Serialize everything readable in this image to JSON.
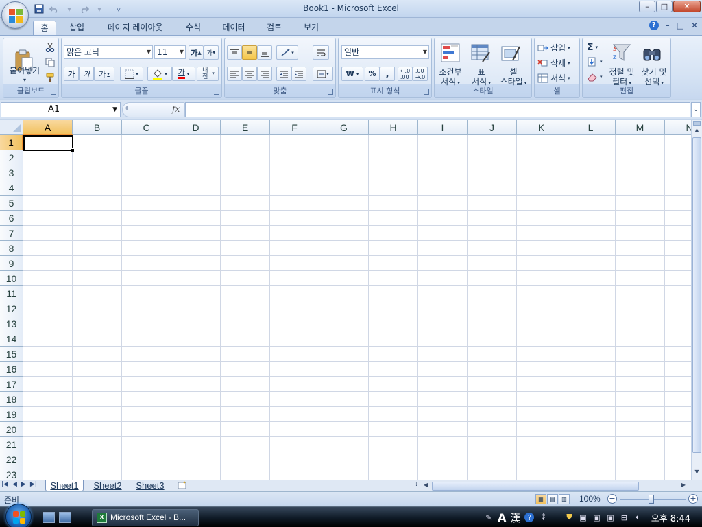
{
  "window": {
    "title": "Book1 - Microsoft Excel",
    "min": "–",
    "restore": "□",
    "close": "✕"
  },
  "qat": {
    "save_icon": "save-icon",
    "undo_icon": "undo-icon",
    "redo_icon": "redo-icon",
    "customize_icon": "qat-customize-icon"
  },
  "tabs": [
    {
      "label": "홈",
      "active": true
    },
    {
      "label": "삽입"
    },
    {
      "label": "페이지 레이아웃"
    },
    {
      "label": "수식"
    },
    {
      "label": "데이터"
    },
    {
      "label": "검토"
    },
    {
      "label": "보기"
    }
  ],
  "ribbon": {
    "clipboard": {
      "label": "클립보드",
      "paste": "붙여넣기"
    },
    "font": {
      "label": "글꼴",
      "font_name": "맑은 고딕",
      "font_size": "11",
      "grow": "가",
      "shrink": "가",
      "bold": "가",
      "italic": "가",
      "underline": "가",
      "font_color": "가",
      "phonetic": "내천"
    },
    "alignment": {
      "label": "맞춤"
    },
    "number": {
      "label": "표시 형식",
      "format": "일반",
      "currency": "₩",
      "percent": "%",
      "comma": ","
    },
    "styles": {
      "label": "스타일",
      "conditional": [
        "조건부",
        "서식"
      ],
      "table": [
        "표",
        "서식"
      ],
      "cell": [
        "셀",
        "스타일"
      ]
    },
    "cells": {
      "label": "셀",
      "insert": "삽입",
      "delete": "삭제",
      "format": "서식"
    },
    "editing": {
      "label": "편집",
      "sum": "Σ",
      "sort": [
        "정렬 및",
        "필터"
      ],
      "find": [
        "찾기 및",
        "선택"
      ]
    }
  },
  "formula_bar": {
    "name_box": "A1",
    "fx": "fx",
    "formula": ""
  },
  "grid": {
    "columns": [
      "A",
      "B",
      "C",
      "D",
      "E",
      "F",
      "G",
      "H",
      "I",
      "J",
      "K",
      "L",
      "M",
      "N"
    ],
    "rows": [
      "1",
      "2",
      "3",
      "4",
      "5",
      "6",
      "7",
      "8",
      "9",
      "10",
      "11",
      "12",
      "13",
      "14",
      "15",
      "16",
      "17",
      "18",
      "19",
      "20",
      "21",
      "22",
      "23"
    ],
    "active_cell": "A1"
  },
  "sheets": [
    {
      "label": "Sheet1",
      "active": true
    },
    {
      "label": "Sheet2"
    },
    {
      "label": "Sheet3"
    }
  ],
  "status": {
    "text": "준비",
    "zoom": "100%",
    "zoom_minus": "−",
    "zoom_plus": "+"
  },
  "taskbar": {
    "task_label": "Microsoft Excel - B...",
    "ime_a": "A",
    "ime_han": "漢",
    "clock": "오후 8:44"
  },
  "colors": {
    "accent_selected_header": "#f1c15f",
    "ribbon_bg": "#d3e1f3",
    "grid_line": "#d0d7e5",
    "header_text": "#27413e"
  }
}
